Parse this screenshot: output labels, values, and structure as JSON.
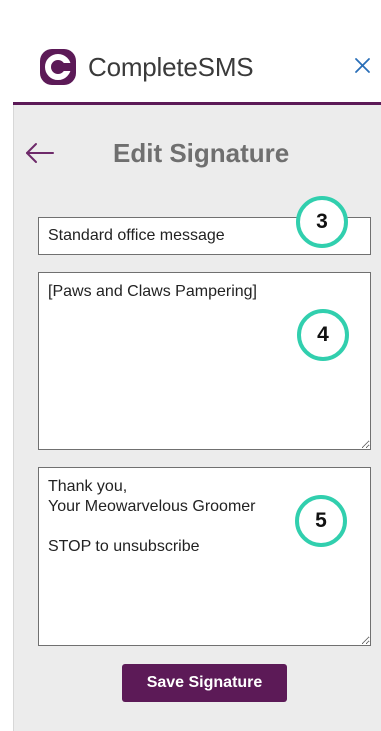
{
  "app": {
    "title": "CompleteSMS",
    "logo_icon": "completesms-logo-icon",
    "brand_color": "#5c1a57"
  },
  "header": {
    "close_icon": "close-icon"
  },
  "page": {
    "title": "Edit Signature",
    "back_icon": "back-arrow-icon"
  },
  "form": {
    "signature_name": "Standard office message",
    "signature_header": "[Paws and Claws Pampering]",
    "signature_footer": "Thank you,\nYour Meowarvelous Groomer\n\nSTOP to unsubscribe",
    "save_label": "Save Signature"
  },
  "callouts": {
    "step_3": "3",
    "step_4": "4",
    "step_5": "5",
    "color": "#31cfae"
  }
}
